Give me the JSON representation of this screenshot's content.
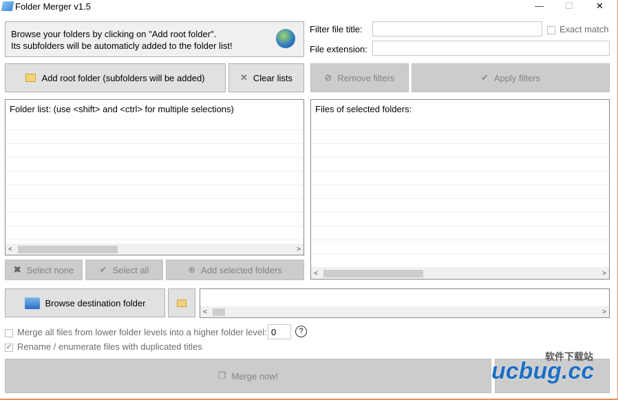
{
  "window": {
    "title": "Folder Merger v1.5",
    "minimize": "—",
    "maximize": "☐",
    "close": "✕"
  },
  "info": {
    "line1": "Browse your folders by clicking on \"Add root folder\".",
    "line2": "Its subfolders will be automaticly added to the folder list!"
  },
  "filters": {
    "title_label": "Filter file title:",
    "title_value": "",
    "exact_match": "Exact match",
    "ext_label": "File extension:",
    "ext_value": ""
  },
  "buttons": {
    "add_root": "Add root folder (subfolders will be added)",
    "clear": "Clear lists",
    "remove_filters": "Remove filters",
    "apply_filters": "Apply filters",
    "select_none": "Select none",
    "select_all": "Select all",
    "add_selected": "Add selected folders",
    "browse_dest": "Browse destination folder",
    "merge": "Merge now!",
    "open_dest": ""
  },
  "folder_list": {
    "header": "Folder list: (use <shift> and <ctrl> for multiple selections)"
  },
  "files_list": {
    "header": "Files of selected folders:"
  },
  "options": {
    "merge_levels_label": "Merge all files from lower folder levels into a higher folder level:",
    "merge_levels_value": "0",
    "merge_levels_checked": false,
    "rename_label": "Rename / enumerate files with duplicated titles",
    "rename_checked": true,
    "help": "?"
  },
  "watermark": {
    "text": "ucbug.cc",
    "subtext": "软件下载站"
  }
}
